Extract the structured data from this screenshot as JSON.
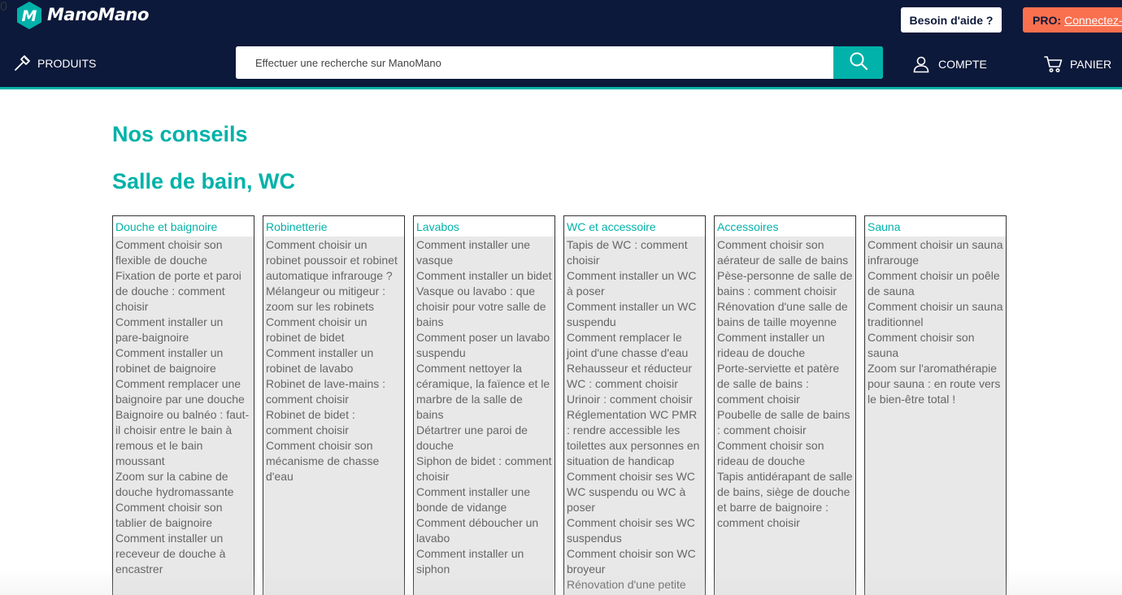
{
  "header": {
    "brand": "ManoMano",
    "help_label": "Besoin d'aide ?",
    "pro_label": "PRO:",
    "pro_link": "Connectez-vous",
    "products_label": "PRODUITS",
    "search_placeholder": "Effectuer une recherche sur ManoMano",
    "account_label": "COMPTE",
    "cart_label": "PANIER",
    "cart_count": "0"
  },
  "main": {
    "title": "Nos conseils",
    "section_title": "Salle de bain, WC",
    "columns": [
      {
        "title": "Douche et baignoire",
        "items": [
          "Comment choisir son flexible de douche",
          "Fixation de porte et paroi de douche : comment choisir",
          "Comment installer un pare-baignoire",
          "Comment installer un robinet de baignoire",
          "Comment remplacer une baignoire par une douche",
          "Baignoire ou balnéo : faut-il choisir entre le bain à remous et le bain moussant",
          "Zoom sur la cabine de douche hydromassante",
          "Comment choisir son tablier de baignoire",
          "Comment installer un receveur de douche à encastrer"
        ]
      },
      {
        "title": "Robinetterie",
        "items": [
          "Comment choisir un robinet poussoir et robinet automatique infrarouge ?",
          "Mélangeur ou mitigeur : zoom sur les robinets",
          "Comment choisir un robinet de bidet",
          "Comment installer un robinet de lavabo",
          "Robinet de lave-mains : comment choisir",
          "Robinet de bidet : comment choisir",
          "Comment choisir son mécanisme de chasse d'eau"
        ]
      },
      {
        "title": "Lavabos",
        "items": [
          "Comment installer une vasque",
          "Comment installer un bidet",
          "Vasque ou lavabo : que choisir pour votre salle de bains",
          "Comment poser un lavabo suspendu",
          "Comment nettoyer la céramique, la faïence et le marbre de la salle de bains",
          "Détartrer une paroi de douche",
          "Siphon de bidet : comment choisir",
          "Comment installer une bonde de vidange",
          "Comment déboucher un lavabo",
          "Comment installer un siphon"
        ]
      },
      {
        "title": "WC et accessoire",
        "items": [
          "Tapis de WC : comment choisir",
          "Comment installer un WC à poser",
          "Comment installer un WC suspendu",
          "Comment remplacer le joint d'une chasse d'eau",
          "Rehausseur et réducteur WC : comment choisir",
          "Urinoir : comment choisir",
          "Réglementation WC PMR : rendre accessible les toilettes aux personnes en situation de handicap",
          "Comment choisir ses WC WC suspendu ou WC à poser",
          "Comment choisir ses WC suspendus",
          "Comment choisir son WC broyeur",
          "Rénovation d'une petite"
        ]
      },
      {
        "title": "Accessoires",
        "items": [
          "Comment choisir son aérateur de salle de bains",
          "Pèse-personne de salle de bains : comment choisir",
          "Rénovation d'une salle de bains de taille moyenne",
          "Comment installer un rideau de douche",
          "Porte-serviette et patère de salle de bains : comment choisir",
          "Poubelle de salle de bains : comment choisir",
          "Comment choisir son rideau de douche",
          "Tapis antidérapant de salle de bains, siège de douche et barre de baignoire : comment choisir"
        ]
      },
      {
        "title": "Sauna",
        "items": [
          "Comment choisir un sauna infrarouge",
          "Comment choisir un poêle de sauna",
          "Comment choisir un sauna traditionnel",
          "Comment choisir son sauna",
          "Zoom sur l'aromathérapie pour sauna : en route vers le bien-être total !"
        ]
      }
    ]
  },
  "colors": {
    "navy": "#0c193a",
    "teal": "#00b2a9",
    "orange": "#f9704f",
    "column_bg": "#e8e8e8"
  },
  "icons": {
    "logo": "manomano-logo-icon",
    "products": "hammer-icon",
    "search": "search-icon",
    "account": "user-icon",
    "cart": "cart-icon"
  }
}
